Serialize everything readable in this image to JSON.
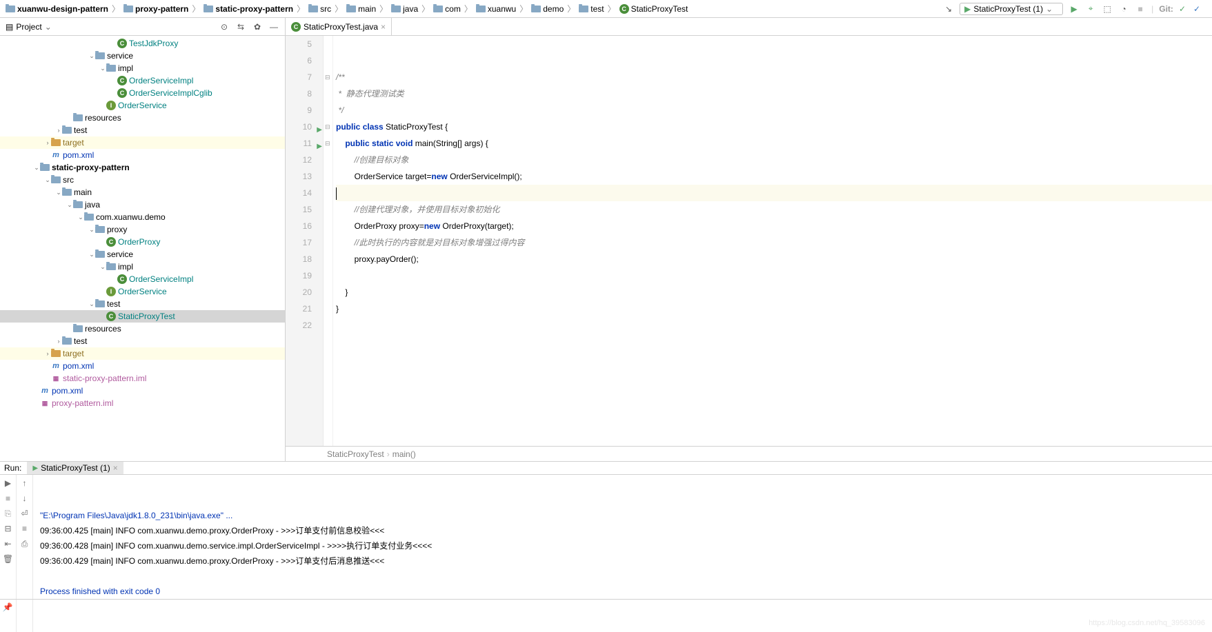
{
  "breadcrumbs": [
    {
      "icon": "folder",
      "label": "xuanwu-design-pattern"
    },
    {
      "icon": "folder",
      "label": "proxy-pattern"
    },
    {
      "icon": "folder",
      "label": "static-proxy-pattern"
    },
    {
      "icon": "folder",
      "label": "src"
    },
    {
      "icon": "folder",
      "label": "main"
    },
    {
      "icon": "folder",
      "label": "java"
    },
    {
      "icon": "folder",
      "label": "com"
    },
    {
      "icon": "folder",
      "label": "xuanwu"
    },
    {
      "icon": "folder",
      "label": "demo"
    },
    {
      "icon": "folder",
      "label": "test"
    },
    {
      "icon": "class",
      "label": "StaticProxyTest"
    }
  ],
  "toolbar": {
    "run_config": "StaticProxyTest (1)",
    "git_label": "Git:"
  },
  "project_panel": {
    "title": "Project",
    "tree": [
      {
        "d": 10,
        "a": "",
        "ic": "class",
        "lbl": "TestJdkProxy",
        "cls": "teal"
      },
      {
        "d": 8,
        "a": "v",
        "ic": "folder",
        "lbl": "service"
      },
      {
        "d": 9,
        "a": "v",
        "ic": "folder",
        "lbl": "impl"
      },
      {
        "d": 10,
        "a": "",
        "ic": "class",
        "lbl": "OrderServiceImpl",
        "cls": "teal"
      },
      {
        "d": 10,
        "a": "",
        "ic": "class",
        "lbl": "OrderServiceImplCglib",
        "cls": "teal"
      },
      {
        "d": 9,
        "a": "",
        "ic": "interface",
        "lbl": "OrderService",
        "cls": "teal"
      },
      {
        "d": 6,
        "a": "",
        "ic": "folder",
        "lbl": "resources"
      },
      {
        "d": 5,
        "a": ">",
        "ic": "folder",
        "lbl": "test"
      },
      {
        "d": 4,
        "a": ">",
        "ic": "folder-orange",
        "lbl": "target",
        "cls": "orange",
        "hl": "target"
      },
      {
        "d": 4,
        "a": "",
        "ic": "m",
        "lbl": "pom.xml",
        "cls": "blue"
      },
      {
        "d": 3,
        "a": "v",
        "ic": "folder",
        "lbl": "static-proxy-pattern",
        "bold": true
      },
      {
        "d": 4,
        "a": "v",
        "ic": "folder",
        "lbl": "src"
      },
      {
        "d": 5,
        "a": "v",
        "ic": "folder",
        "lbl": "main"
      },
      {
        "d": 6,
        "a": "v",
        "ic": "folder",
        "lbl": "java"
      },
      {
        "d": 7,
        "a": "v",
        "ic": "folder",
        "lbl": "com.xuanwu.demo"
      },
      {
        "d": 8,
        "a": "v",
        "ic": "folder",
        "lbl": "proxy"
      },
      {
        "d": 9,
        "a": "",
        "ic": "class",
        "lbl": "OrderProxy",
        "cls": "teal"
      },
      {
        "d": 8,
        "a": "v",
        "ic": "folder",
        "lbl": "service"
      },
      {
        "d": 9,
        "a": "v",
        "ic": "folder",
        "lbl": "impl"
      },
      {
        "d": 10,
        "a": "",
        "ic": "class",
        "lbl": "OrderServiceImpl",
        "cls": "teal"
      },
      {
        "d": 9,
        "a": "",
        "ic": "interface",
        "lbl": "OrderService",
        "cls": "teal"
      },
      {
        "d": 8,
        "a": "v",
        "ic": "folder",
        "lbl": "test"
      },
      {
        "d": 9,
        "a": "",
        "ic": "class",
        "lbl": "StaticProxyTest",
        "cls": "teal",
        "sel": true
      },
      {
        "d": 6,
        "a": "",
        "ic": "folder",
        "lbl": "resources"
      },
      {
        "d": 5,
        "a": ">",
        "ic": "folder",
        "lbl": "test"
      },
      {
        "d": 4,
        "a": ">",
        "ic": "folder-orange",
        "lbl": "target",
        "cls": "orange",
        "hl": "target"
      },
      {
        "d": 4,
        "a": "",
        "ic": "m",
        "lbl": "pom.xml",
        "cls": "blue"
      },
      {
        "d": 4,
        "a": "",
        "ic": "iml",
        "lbl": "static-proxy-pattern.iml",
        "cls": "purple"
      },
      {
        "d": 3,
        "a": "",
        "ic": "m",
        "lbl": "pom.xml",
        "cls": "blue"
      },
      {
        "d": 3,
        "a": "",
        "ic": "iml",
        "lbl": "proxy-pattern.iml",
        "cls": "purple"
      }
    ]
  },
  "editor": {
    "tab_label": "StaticProxyTest.java",
    "lines": [
      {
        "n": 5,
        "html": ""
      },
      {
        "n": 6,
        "html": ""
      },
      {
        "n": 7,
        "html": "<span class='cm'>/**</span>"
      },
      {
        "n": 8,
        "html": "<span class='cm'> *  静态代理测试类</span>"
      },
      {
        "n": 9,
        "html": "<span class='cm'> */</span>"
      },
      {
        "n": 10,
        "run": true,
        "html": "<span class='kw'>public</span> <span class='kw'>class</span> StaticProxyTest {"
      },
      {
        "n": 11,
        "run": true,
        "html": "    <span class='kw'>public</span> <span class='kw'>static</span> <span class='kw'>void</span> main(String[] args) {"
      },
      {
        "n": 12,
        "html": "        <span class='cm'>//创建目标对象</span>"
      },
      {
        "n": 13,
        "html": "        OrderService target=<span class='kw'>new</span> OrderServiceImpl();"
      },
      {
        "n": 14,
        "cur": true,
        "html": "<span class='caret'></span>"
      },
      {
        "n": 15,
        "html": "        <span class='cm'>//创建代理对象，并使用目标对象初始化</span>"
      },
      {
        "n": 16,
        "html": "        OrderProxy proxy=<span class='kw'>new</span> OrderProxy(target);"
      },
      {
        "n": 17,
        "html": "        <span class='cm'>//此时执行的内容就是对目标对象增强过得内容</span>"
      },
      {
        "n": 18,
        "html": "        proxy.payOrder();"
      },
      {
        "n": 19,
        "html": ""
      },
      {
        "n": 20,
        "html": "    }"
      },
      {
        "n": 21,
        "html": "}"
      },
      {
        "n": 22,
        "html": ""
      }
    ],
    "crumb1": "StaticProxyTest",
    "crumb2": "main()"
  },
  "run": {
    "label": "Run:",
    "tab": "StaticProxyTest (1)",
    "lines": [
      {
        "cls": "blue-txt",
        "txt": "\"E:\\Program Files\\Java\\jdk1.8.0_231\\bin\\java.exe\" ..."
      },
      {
        "cls": "",
        "txt": "09:36:00.425 [main] INFO com.xuanwu.demo.proxy.OrderProxy - >>>订单支付前信息校验<<<"
      },
      {
        "cls": "",
        "txt": "09:36:00.428 [main] INFO com.xuanwu.demo.service.impl.OrderServiceImpl - >>>>执行订单支付业务<<<<"
      },
      {
        "cls": "",
        "txt": "09:36:00.429 [main] INFO com.xuanwu.demo.proxy.OrderProxy - >>>订单支付后消息推送<<<"
      },
      {
        "cls": "",
        "txt": ""
      },
      {
        "cls": "blue-txt",
        "txt": "Process finished with exit code 0"
      }
    ],
    "watermark": "https://blog.csdn.net/hq_39583096"
  }
}
